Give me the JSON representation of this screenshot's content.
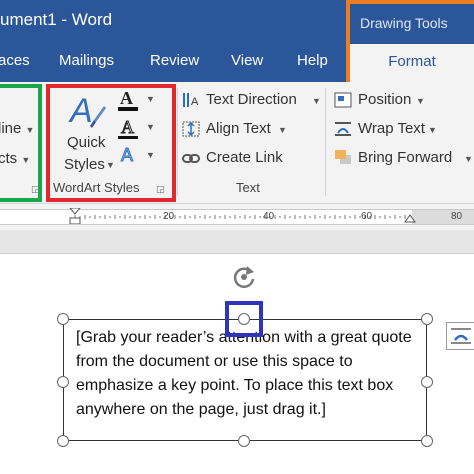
{
  "window": {
    "title": "ument1  -  Word"
  },
  "tabs": [
    {
      "label": "aces"
    },
    {
      "label": "Mailings"
    },
    {
      "label": "Review"
    },
    {
      "label": "View"
    },
    {
      "label": "Help"
    }
  ],
  "contextual_tab": {
    "header": "Drawing Tools",
    "active_tab": "Format"
  },
  "ribbon": {
    "left_group": {
      "item1": "line",
      "item2": "cts"
    },
    "wordart_styles": {
      "quick_styles_line1": "Quick",
      "quick_styles_line2": "Styles",
      "group_label": "WordArt Styles"
    },
    "text_group": {
      "text_direction": "Text Direction",
      "align_text": "Align Text",
      "create_link": "Create Link",
      "group_label": "Text"
    },
    "arrange_group": {
      "position": "Position",
      "wrap_text": "Wrap Text",
      "bring_forward": "Bring Forward"
    }
  },
  "ruler": {
    "marks": [
      "20",
      "40",
      "60",
      "80"
    ]
  },
  "textbox": {
    "content": "[Grab your reader’s attention with a great quote from the document or use this space to emphasize a key point. To place this text box anywhere on the page, just drag it.]"
  },
  "colors": {
    "word_blue": "#2b579a",
    "highlight_orange": "#ee7d22",
    "highlight_green": "#18a84a",
    "highlight_red": "#e0282e",
    "highlight_blue": "#2d35bd"
  }
}
